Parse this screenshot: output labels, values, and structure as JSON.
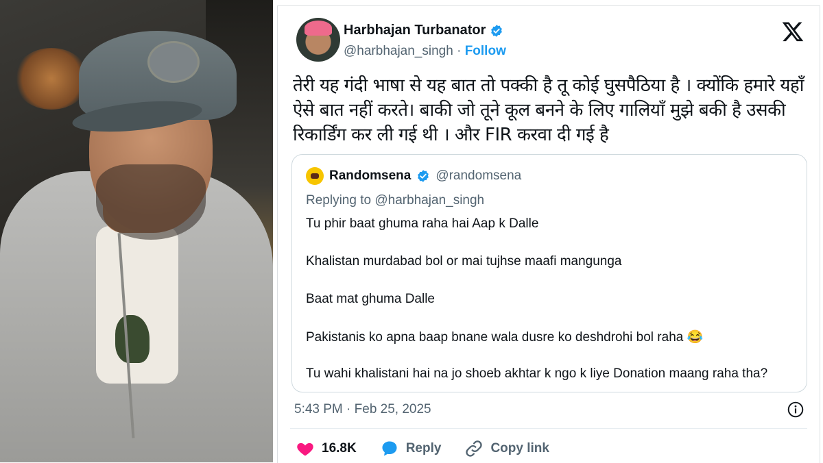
{
  "tweet": {
    "author_name": "Harbhajan Turbanator",
    "author_handle": "@harbhajan_singh",
    "separator": "·",
    "follow_label": "Follow",
    "text": "तेरी यह गंदी भाषा से यह बात तो पक्की है तू कोई घुसपैठिया है । क्योंकि हमारे यहाँ ऐसे बात नहीं करते। बाकी जो तूने कूल बनने के लिए गालियाँ मुझे बकी है उसकी रिकार्डिंग कर ली गई थी । और FIR करवा दी गई है",
    "timestamp": "5:43 PM · Feb 25, 2025",
    "likes": "16.8K",
    "reply_label": "Reply",
    "copy_link_label": "Copy link"
  },
  "quote": {
    "author_name": "Randomsena",
    "author_handle": "@randomsena",
    "replying_to": "Replying to @harbhajan_singh",
    "lines": [
      "Tu phir baat ghuma raha hai Aap k Dalle",
      "Khalistan murdabad bol or mai tujhse maafi mangunga",
      "Baat mat ghuma Dalle",
      "Pakistanis ko apna baap bnane wala dusre ko deshdrohi bol raha 😂",
      "Tu wahi khalistani hai na jo shoeb akhtar k ngo k liye Donation maang raha tha?"
    ]
  },
  "colors": {
    "accent": "#1d9bf0",
    "like": "#f91880",
    "text_primary": "#0f1419",
    "text_secondary": "#536471"
  },
  "icons": {
    "verified": "verified-badge-icon",
    "platform": "x-logo-icon",
    "info": "info-icon",
    "like": "heart-icon",
    "reply": "speech-bubble-icon",
    "copy": "link-icon"
  }
}
